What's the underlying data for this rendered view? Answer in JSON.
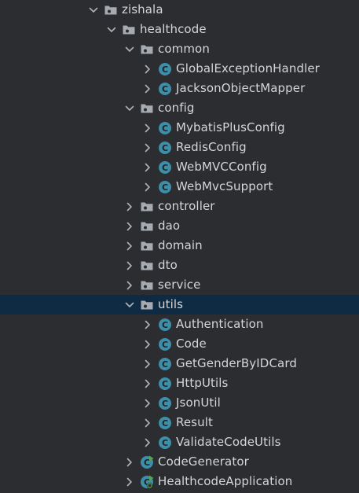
{
  "colors": {
    "background": "#2b2d30",
    "selected_row": "#0f2b44",
    "text": "#d4d6da",
    "chevron": "#aeb2b8",
    "folder": "#a6aab1",
    "class_icon": "#3d8ea8",
    "class_icon_letter": "#1e2124",
    "runnable_badge": "#57a64a"
  },
  "tree": [
    {
      "id": "zishala",
      "label": "zishala",
      "type": "package",
      "depth": 0,
      "expanded": true,
      "icon": "folder-icon"
    },
    {
      "id": "healthcode",
      "label": "healthcode",
      "type": "package",
      "depth": 1,
      "expanded": true,
      "icon": "folder-icon"
    },
    {
      "id": "common",
      "label": "common",
      "type": "package",
      "depth": 2,
      "expanded": true,
      "icon": "folder-icon"
    },
    {
      "id": "globalexceptionhandler",
      "label": "GlobalExceptionHandler",
      "type": "class",
      "depth": 3,
      "expanded": false,
      "icon": "class-icon"
    },
    {
      "id": "jacksonobjectmapper",
      "label": "JacksonObjectMapper",
      "type": "class",
      "depth": 3,
      "expanded": false,
      "icon": "class-icon"
    },
    {
      "id": "config",
      "label": "config",
      "type": "package",
      "depth": 2,
      "expanded": true,
      "icon": "folder-icon"
    },
    {
      "id": "mybatisplusconfig",
      "label": "MybatisPlusConfig",
      "type": "class",
      "depth": 3,
      "expanded": false,
      "icon": "class-icon"
    },
    {
      "id": "redisconfig",
      "label": "RedisConfig",
      "type": "class",
      "depth": 3,
      "expanded": false,
      "icon": "class-icon"
    },
    {
      "id": "webmvcconfig",
      "label": "WebMVCConfig",
      "type": "class",
      "depth": 3,
      "expanded": false,
      "icon": "class-icon"
    },
    {
      "id": "webmvcsupport",
      "label": "WebMvcSupport",
      "type": "class",
      "depth": 3,
      "expanded": false,
      "icon": "class-icon"
    },
    {
      "id": "controller",
      "label": "controller",
      "type": "package",
      "depth": 2,
      "expanded": false,
      "icon": "folder-icon"
    },
    {
      "id": "dao",
      "label": "dao",
      "type": "package",
      "depth": 2,
      "expanded": false,
      "icon": "folder-icon"
    },
    {
      "id": "domain",
      "label": "domain",
      "type": "package",
      "depth": 2,
      "expanded": false,
      "icon": "folder-icon"
    },
    {
      "id": "dto",
      "label": "dto",
      "type": "package",
      "depth": 2,
      "expanded": false,
      "icon": "folder-icon"
    },
    {
      "id": "service",
      "label": "service",
      "type": "package",
      "depth": 2,
      "expanded": false,
      "icon": "folder-icon"
    },
    {
      "id": "utils",
      "label": "utils",
      "type": "package",
      "depth": 2,
      "expanded": true,
      "selected": true,
      "icon": "folder-icon"
    },
    {
      "id": "authentication",
      "label": "Authentication",
      "type": "class",
      "depth": 3,
      "expanded": false,
      "icon": "class-icon"
    },
    {
      "id": "code",
      "label": "Code",
      "type": "class",
      "depth": 3,
      "expanded": false,
      "icon": "class-icon"
    },
    {
      "id": "getgenderbyidcard",
      "label": "GetGenderByIDCard",
      "type": "class",
      "depth": 3,
      "expanded": false,
      "icon": "class-icon"
    },
    {
      "id": "httputils",
      "label": "HttpUtils",
      "type": "class",
      "depth": 3,
      "expanded": false,
      "icon": "class-icon"
    },
    {
      "id": "jsonutil",
      "label": "JsonUtil",
      "type": "class",
      "depth": 3,
      "expanded": false,
      "icon": "class-icon"
    },
    {
      "id": "result",
      "label": "Result",
      "type": "class",
      "depth": 3,
      "expanded": false,
      "icon": "class-icon"
    },
    {
      "id": "validatecodeutils",
      "label": "ValidateCodeUtils",
      "type": "class",
      "depth": 3,
      "expanded": false,
      "icon": "class-icon"
    },
    {
      "id": "codegenerator",
      "label": "CodeGenerator",
      "type": "runnable-class",
      "depth": 2,
      "expanded": false,
      "icon": "runnable-class-icon"
    },
    {
      "id": "healthcodeapplication",
      "label": "HealthcodeApplication",
      "type": "spring-boot-class",
      "depth": 2,
      "expanded": false,
      "icon": "spring-boot-class-icon"
    }
  ]
}
